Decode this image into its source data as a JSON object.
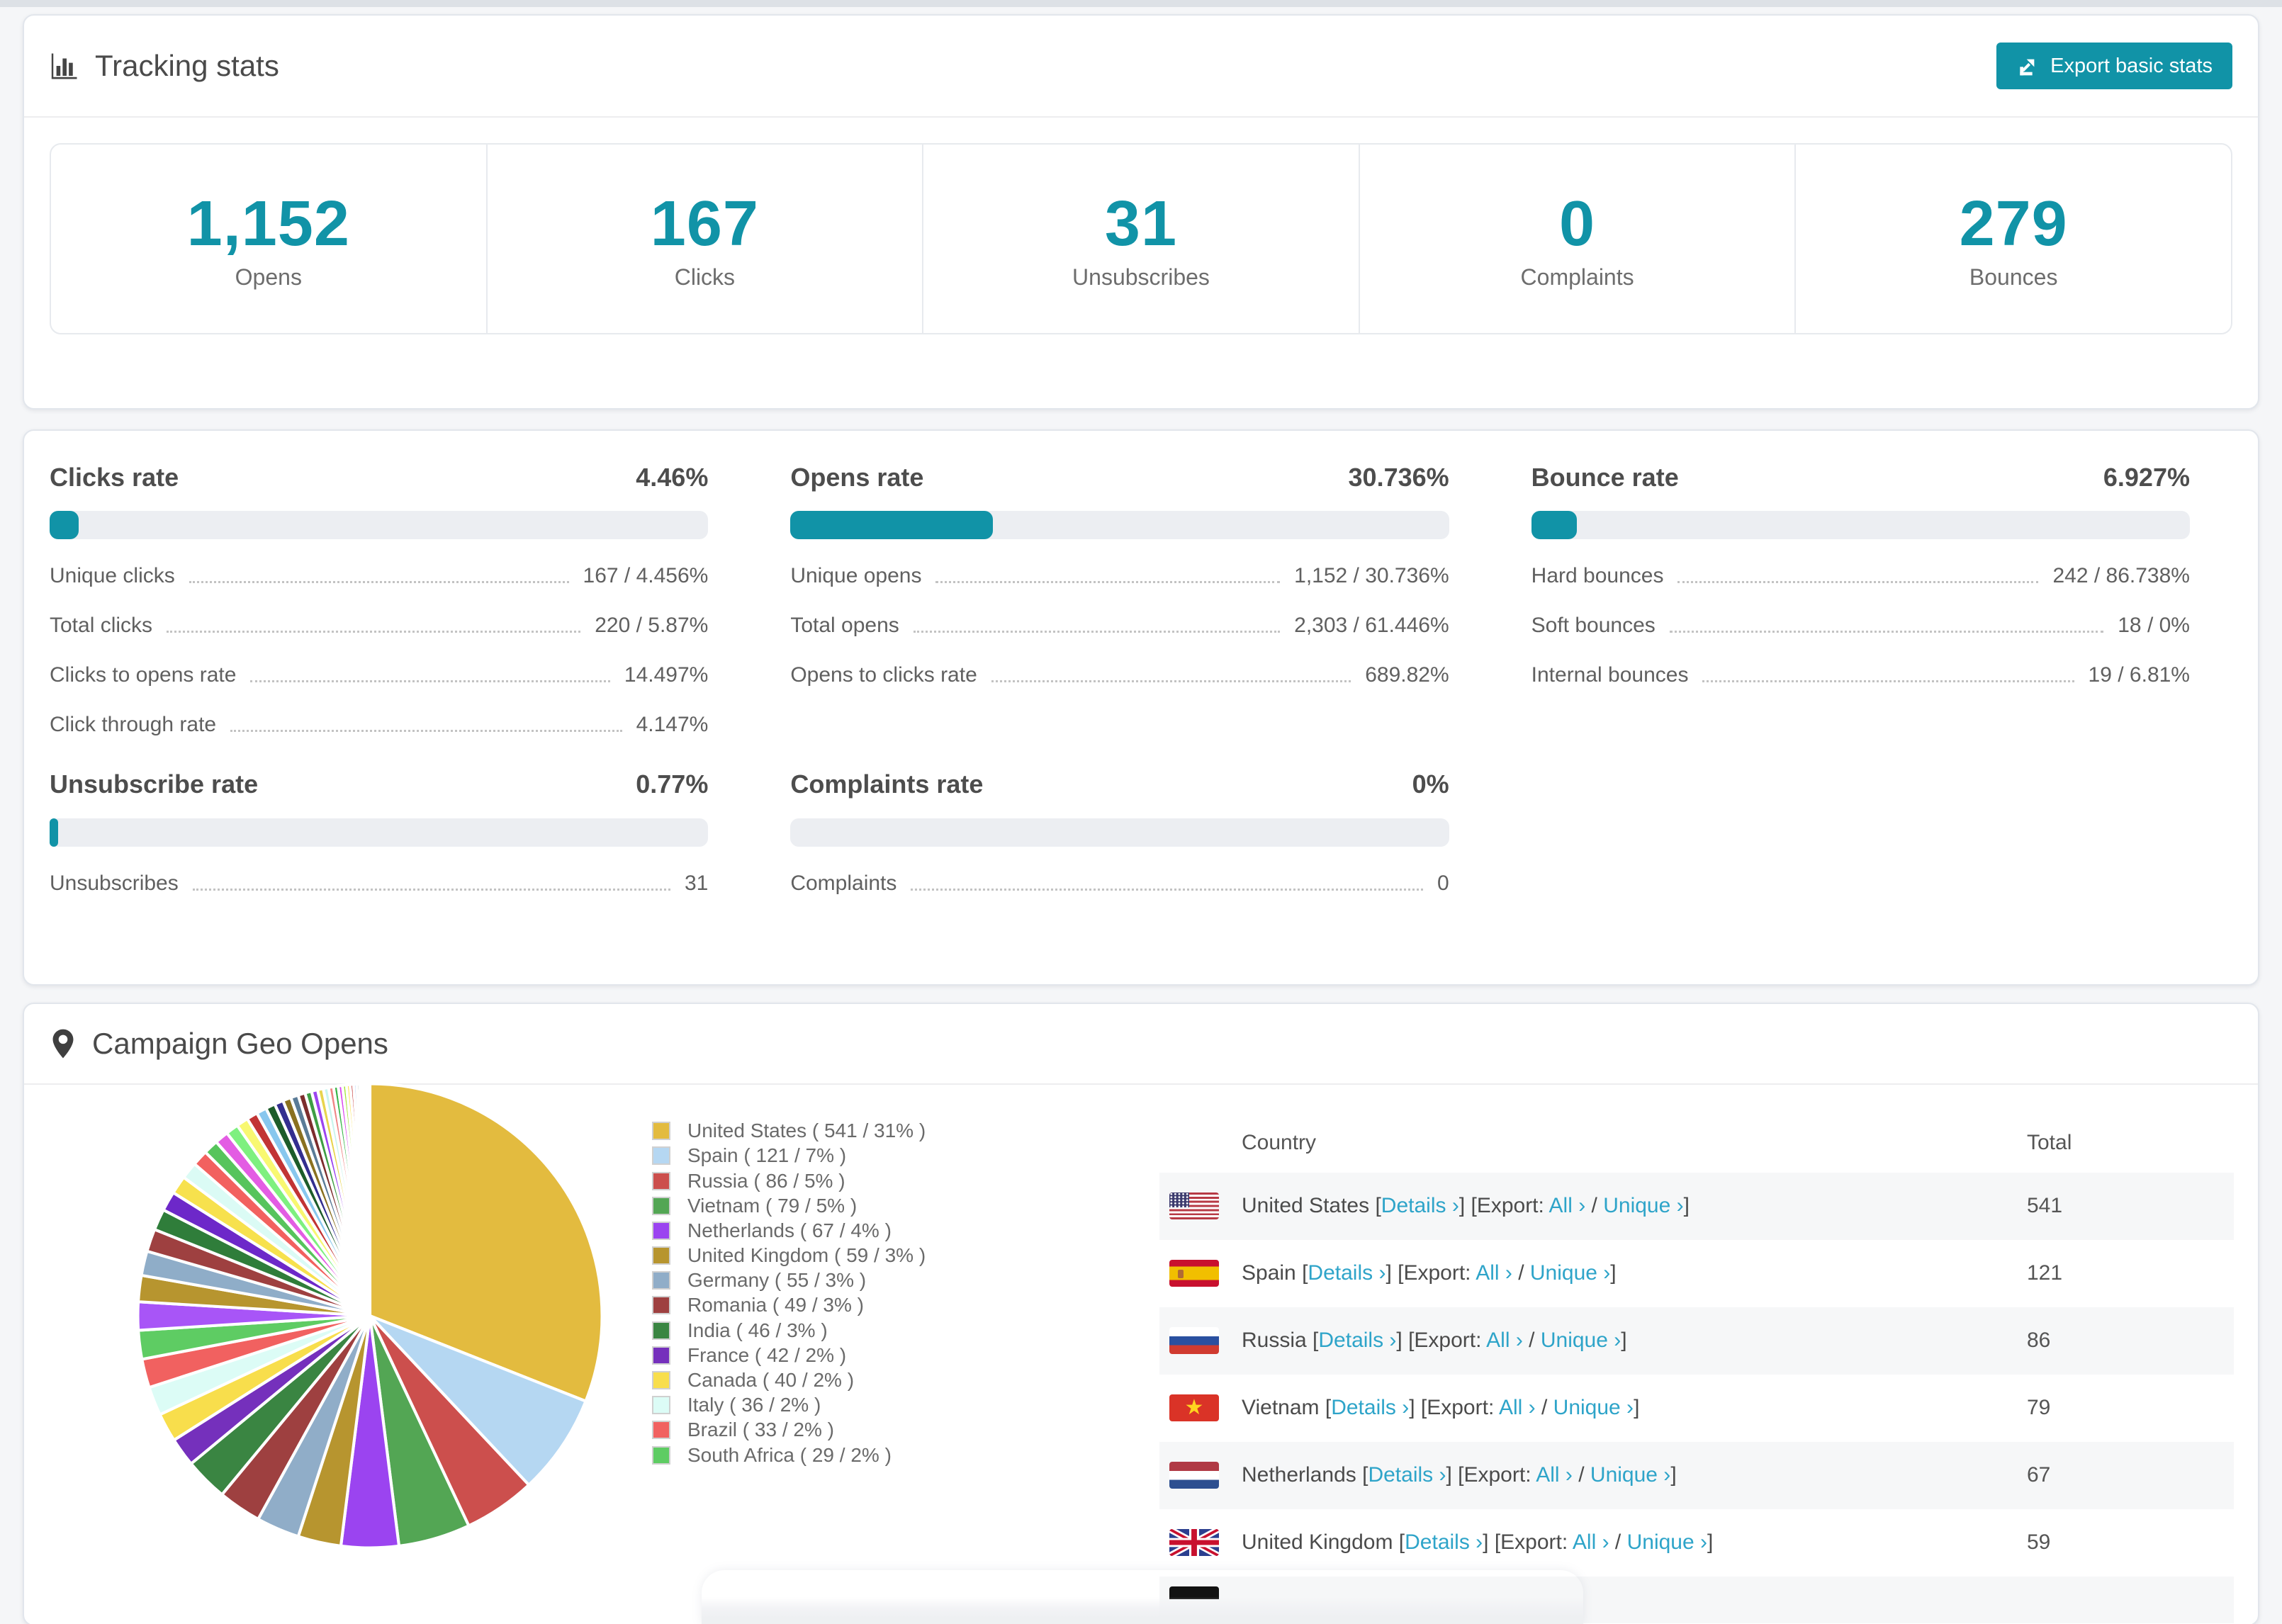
{
  "accent": "#1193a7",
  "link_color": "#2ea4c9",
  "tracking": {
    "title": "Tracking stats",
    "export_label": "Export basic stats",
    "stats": [
      {
        "value": "1,152",
        "label": "Opens"
      },
      {
        "value": "167",
        "label": "Clicks"
      },
      {
        "value": "31",
        "label": "Unsubscribes"
      },
      {
        "value": "0",
        "label": "Complaints"
      },
      {
        "value": "279",
        "label": "Bounces"
      }
    ]
  },
  "rates": [
    {
      "title": "Clicks rate",
      "value": "4.46%",
      "percent": 4.46,
      "rows": [
        {
          "label": "Unique clicks",
          "value": "167 / 4.456%"
        },
        {
          "label": "Total clicks",
          "value": "220 / 5.87%"
        },
        {
          "label": "Clicks to opens rate",
          "value": "14.497%"
        },
        {
          "label": "Click through rate",
          "value": "4.147%"
        }
      ]
    },
    {
      "title": "Opens rate",
      "value": "30.736%",
      "percent": 30.736,
      "rows": [
        {
          "label": "Unique opens",
          "value": "1,152 / 30.736%"
        },
        {
          "label": "Total opens",
          "value": "2,303 / 61.446%"
        },
        {
          "label": "Opens to clicks rate",
          "value": "689.82%"
        }
      ]
    },
    {
      "title": "Bounce rate",
      "value": "6.927%",
      "percent": 6.927,
      "rows": [
        {
          "label": "Hard bounces",
          "value": "242 / 86.738%"
        },
        {
          "label": "Soft bounces",
          "value": "18 / 0%"
        },
        {
          "label": "Internal bounces",
          "value": "19 / 6.81%"
        }
      ]
    },
    {
      "title": "Unsubscribe rate",
      "value": "0.77%",
      "percent": 0.77,
      "rows": [
        {
          "label": "Unsubscribes",
          "value": "31"
        }
      ]
    },
    {
      "title": "Complaints rate",
      "value": "0%",
      "percent": 0,
      "rows": [
        {
          "label": "Complaints",
          "value": "0"
        }
      ]
    }
  ],
  "geo": {
    "title": "Campaign Geo Opens",
    "table_headers": {
      "country": "Country",
      "total": "Total"
    },
    "link_labels": {
      "details": "Details ›",
      "export_prefix": "[Export: ",
      "all": "All ›",
      "separator": " / ",
      "unique": "Unique ›",
      "open_bracket": "[",
      "close_bracket": "]"
    },
    "countries": [
      {
        "name": "United States",
        "flag": "us",
        "total": "541"
      },
      {
        "name": "Spain",
        "flag": "es",
        "total": "121"
      },
      {
        "name": "Russia",
        "flag": "ru",
        "total": "86"
      },
      {
        "name": "Vietnam",
        "flag": "vn",
        "total": "79"
      },
      {
        "name": "Netherlands",
        "flag": "nl",
        "total": "67"
      },
      {
        "name": "United Kingdom",
        "flag": "uk",
        "total": "59"
      }
    ],
    "cut_row_flag": "de",
    "chart_data": {
      "type": "pie",
      "legend": [
        {
          "name": "United States",
          "count": 541,
          "pct": 31,
          "color": "#e3bb3f"
        },
        {
          "name": "Spain",
          "count": 121,
          "pct": 7,
          "color": "#b5d7f2"
        },
        {
          "name": "Russia",
          "count": 86,
          "pct": 5,
          "color": "#cc4f4d"
        },
        {
          "name": "Vietnam",
          "count": 79,
          "pct": 5,
          "color": "#53a654"
        },
        {
          "name": "Netherlands",
          "count": 67,
          "pct": 4,
          "color": "#9b44f0"
        },
        {
          "name": "United Kingdom",
          "count": 59,
          "pct": 3,
          "color": "#b7952f"
        },
        {
          "name": "Germany",
          "count": 55,
          "pct": 3,
          "color": "#90adc8"
        },
        {
          "name": "Romania",
          "count": 49,
          "pct": 3,
          "color": "#9e4040"
        },
        {
          "name": "India",
          "count": 46,
          "pct": 3,
          "color": "#3a8542"
        },
        {
          "name": "France",
          "count": 42,
          "pct": 2,
          "color": "#7530bc"
        },
        {
          "name": "Canada",
          "count": 40,
          "pct": 2,
          "color": "#f8de4c"
        },
        {
          "name": "Italy",
          "count": 36,
          "pct": 2,
          "color": "#dcfcf6"
        },
        {
          "name": "Brazil",
          "count": 33,
          "pct": 2,
          "color": "#f16160"
        },
        {
          "name": "South Africa",
          "count": 29,
          "pct": 2,
          "color": "#5ecc63"
        }
      ],
      "others": {
        "count": 36,
        "decay": 0.93,
        "palette": [
          "#a855f7",
          "#b7952f",
          "#8fadc8",
          "#9e4040",
          "#2f7d3a",
          "#6d28c9",
          "#f7e14d",
          "#dbfbf5",
          "#f2615f",
          "#57c45c",
          "#e35ce3",
          "#7ef07f",
          "#f8f871",
          "#c23434",
          "#88c7ee",
          "#1d5c2a",
          "#332e8f",
          "#8a7020",
          "#5a7b97",
          "#7c2d2d",
          "#3e9e44",
          "#9b44f0",
          "#e8d44d",
          "#caf5ee",
          "#ef8585",
          "#39b54a",
          "#d946ef",
          "#a3e635",
          "#fde047",
          "#b91c1c",
          "#93c5fd",
          "#14532d",
          "#4c1d95",
          "#a16207",
          "#64748b",
          "#7f1d1d"
        ]
      }
    }
  }
}
